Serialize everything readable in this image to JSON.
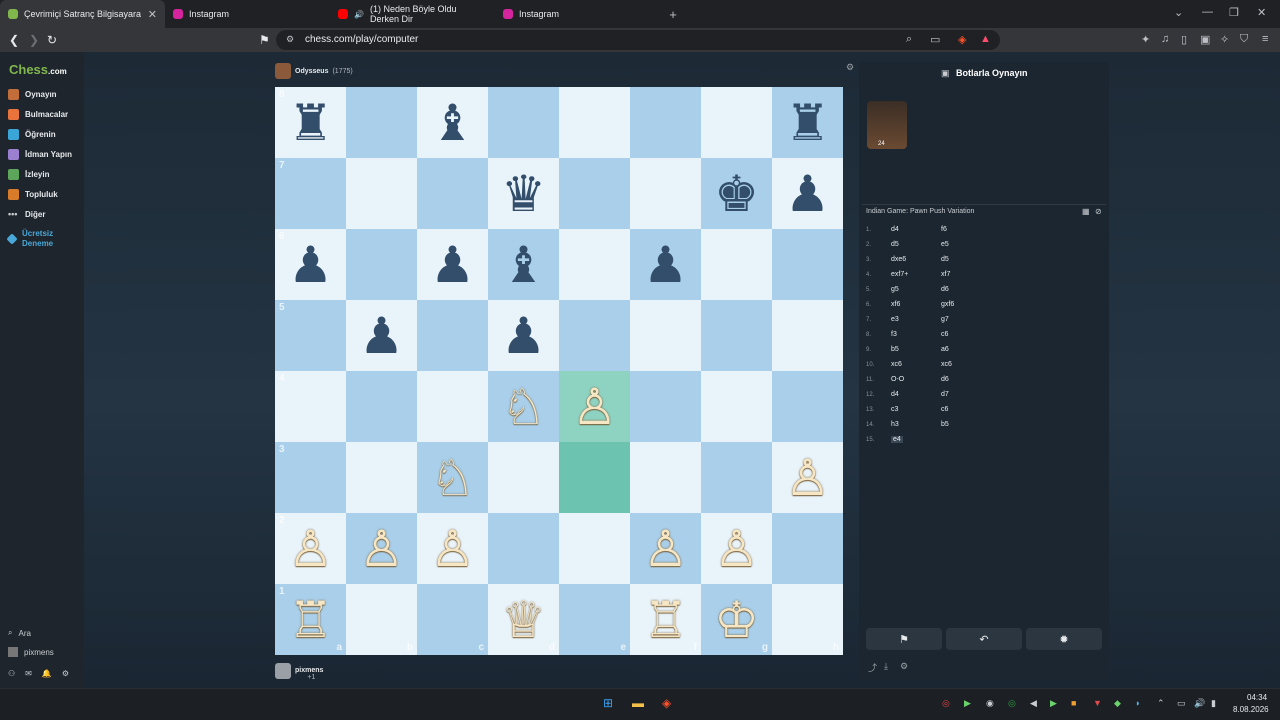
{
  "tabs": [
    {
      "title": "Çevrimiçi Satranç Bilgisayara",
      "active": true
    },
    {
      "title": "Instagram",
      "active": false
    },
    {
      "title": "(1) Neden Böyle Oldu Derken Dir",
      "active": false
    },
    {
      "title": "Instagram",
      "active": false
    }
  ],
  "address": {
    "url": "chess.com/play/computer"
  },
  "brand": {
    "name": "Chess",
    "suffix": ".com"
  },
  "nav": [
    {
      "label": "Oynayın",
      "color": "#e8eaed"
    },
    {
      "label": "Bulmacalar",
      "color": "#e8eaed"
    },
    {
      "label": "Öğrenin",
      "color": "#e8eaed"
    },
    {
      "label": "İdman Yapın",
      "color": "#e8eaed"
    },
    {
      "label": "İzleyin",
      "color": "#e8eaed"
    },
    {
      "label": "Topluluk",
      "color": "#e8eaed"
    },
    {
      "label": "Diğer",
      "color": "#e8eaed"
    },
    {
      "label": "Ücretsiz Deneme",
      "color": "#4aa8d8"
    }
  ],
  "bottom_nav": {
    "search": "Ara",
    "user": "pixmens"
  },
  "opponent": {
    "name": "Odysseus",
    "rating": "(1775)"
  },
  "player": {
    "name": "pixmens",
    "captured": "+1"
  },
  "board": {
    "ranks": [
      "8",
      "7",
      "6",
      "5",
      "4",
      "3",
      "2",
      "1"
    ],
    "files": [
      "a",
      "b",
      "c",
      "d",
      "e",
      "f",
      "g",
      "h"
    ],
    "pieces": [
      [
        "br",
        "",
        "bb",
        "",
        "",
        "",
        "",
        "br"
      ],
      [
        "",
        "",
        "",
        "bq",
        "",
        "",
        "bk",
        "bp"
      ],
      [
        "bp",
        "",
        "bp",
        "bb",
        "",
        "bp",
        "",
        ""
      ],
      [
        "",
        "bp",
        "",
        "bp",
        "",
        "",
        "",
        ""
      ],
      [
        "",
        "",
        "",
        "wn",
        "wp",
        "",
        "",
        ""
      ],
      [
        "",
        "",
        "wn",
        "",
        "",
        "",
        "",
        "wp"
      ],
      [
        "wp",
        "wp",
        "wp",
        "",
        "",
        "wp",
        "wp",
        ""
      ],
      [
        "wr",
        "",
        "",
        "wq",
        "",
        "wr",
        "wk",
        ""
      ]
    ],
    "highlights": [
      {
        "rank": 4,
        "file": 4
      },
      {
        "rank": 5,
        "file": 4
      }
    ]
  },
  "panel": {
    "title": "Botlarla Oynayın",
    "bot_level": "24",
    "opening": "Indian Game: Pawn Push Variation",
    "moves": [
      {
        "n": "1.",
        "w": "d4",
        "b": "f6"
      },
      {
        "n": "2.",
        "w": "d5",
        "b": "e5"
      },
      {
        "n": "3.",
        "w": "dxe6",
        "b": "d5"
      },
      {
        "n": "4.",
        "w": "exf7+",
        "b": "xf7"
      },
      {
        "n": "5.",
        "w": "g5",
        "b": "d6"
      },
      {
        "n": "6.",
        "w": "xf6",
        "b": "gxf6"
      },
      {
        "n": "7.",
        "w": "e3",
        "b": "g7"
      },
      {
        "n": "8.",
        "w": "f3",
        "b": "c6"
      },
      {
        "n": "9.",
        "w": "b5",
        "b": "a6"
      },
      {
        "n": "10.",
        "w": "xc6",
        "b": "xc6"
      },
      {
        "n": "11.",
        "w": "O-O",
        "b": "d6"
      },
      {
        "n": "12.",
        "w": "d4",
        "b": "d7"
      },
      {
        "n": "13.",
        "w": "c3",
        "b": "c6"
      },
      {
        "n": "14.",
        "w": "h3",
        "b": "b5"
      },
      {
        "n": "15.",
        "w": "e4",
        "b": ""
      }
    ]
  },
  "taskbar": {
    "time": "04:34",
    "date": "8.08.2026"
  }
}
